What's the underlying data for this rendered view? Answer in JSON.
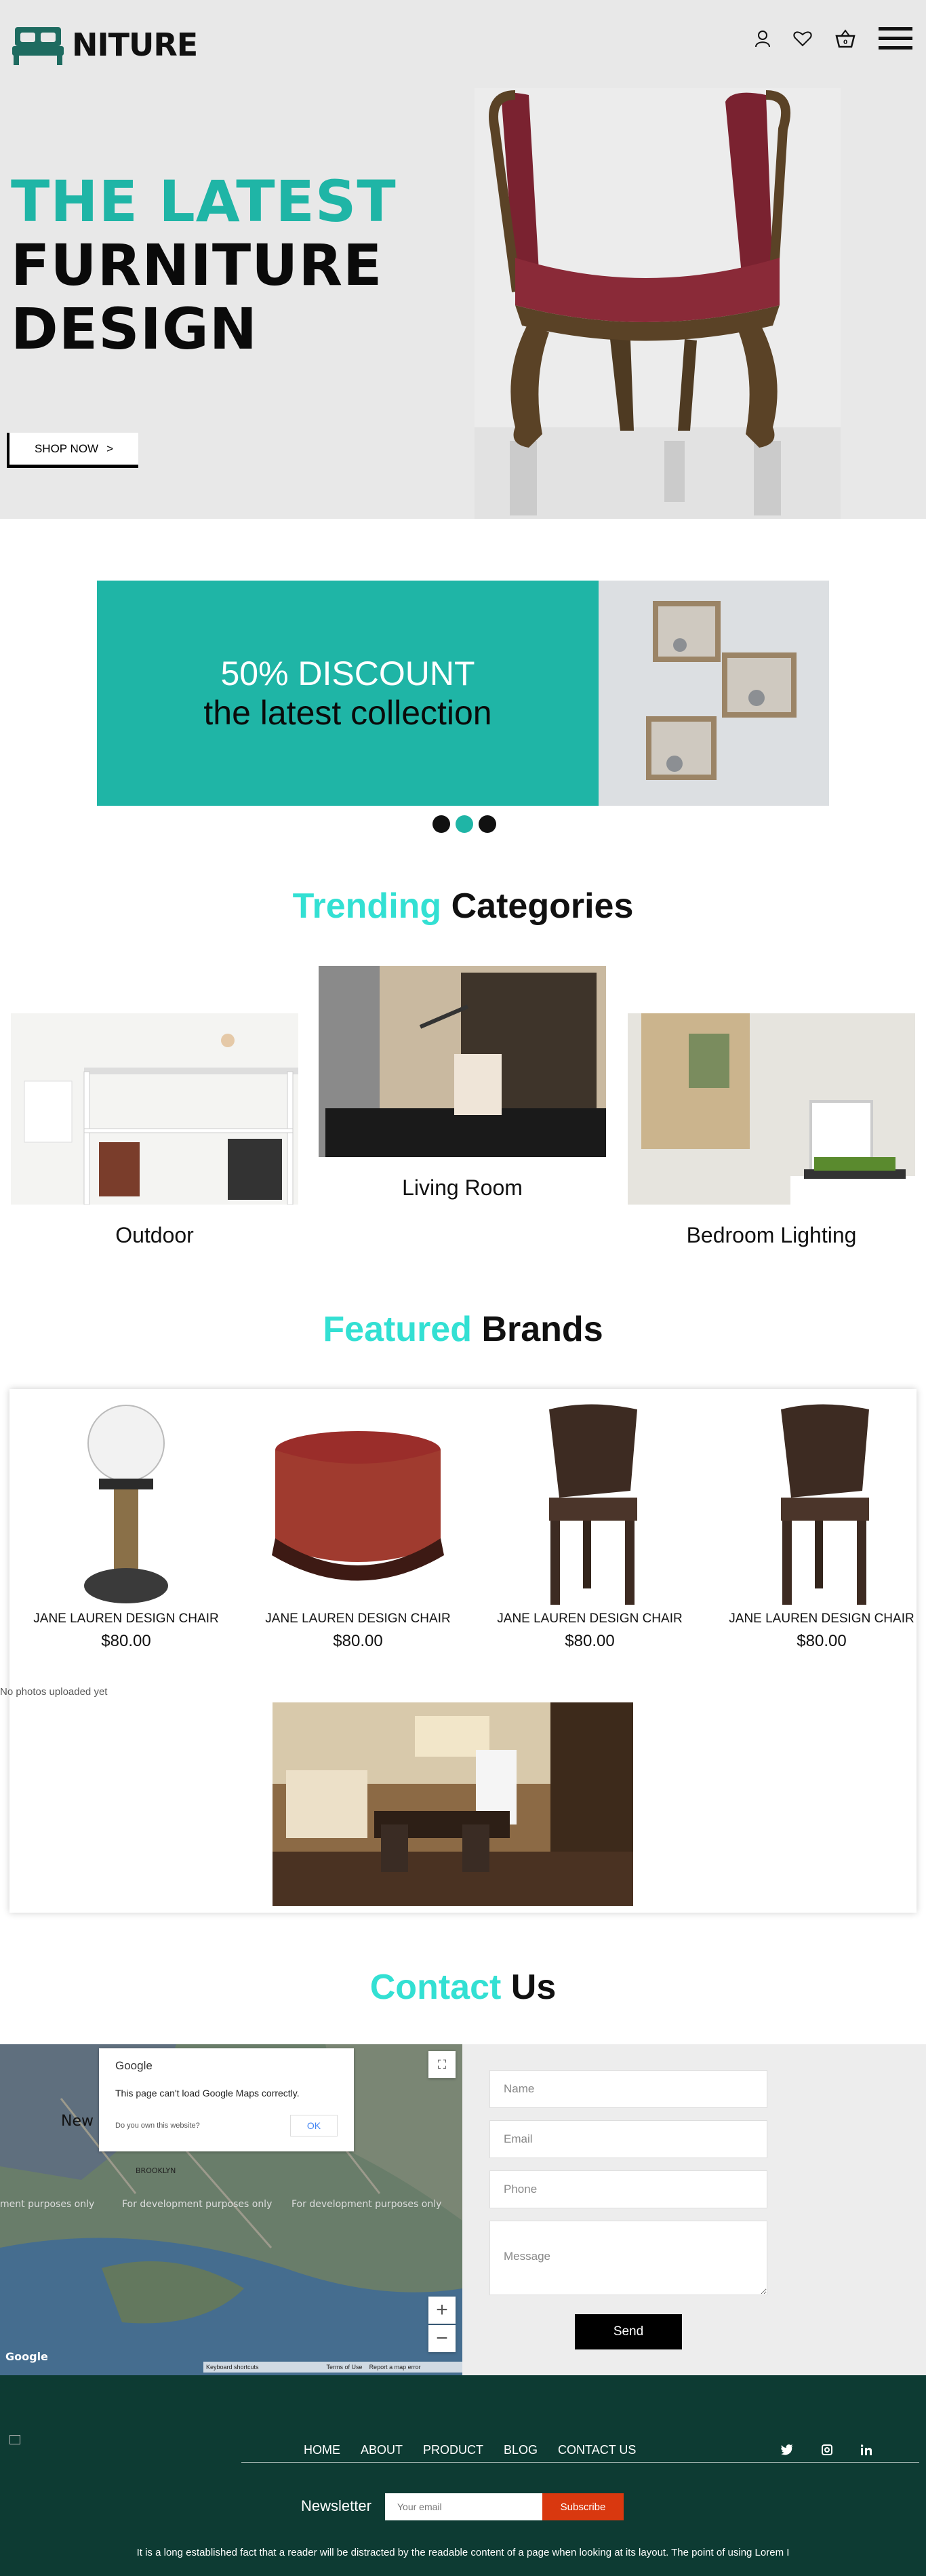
{
  "brand": {
    "name": "NITURE",
    "accent": "#1fb5a6",
    "dark": "#0d3b33"
  },
  "header": {
    "icons": [
      "user-icon",
      "heart-icon",
      "cart-icon",
      "menu-icon"
    ]
  },
  "hero": {
    "line1": "THE LATEST",
    "line2": "FURNITURE",
    "line3": "DESIGN",
    "cta": "SHOP NOW",
    "cta_arrow": ">"
  },
  "banner": {
    "line1": "50% DISCOUNT",
    "line2": "the latest collection",
    "slides": 3,
    "active_slide": 2
  },
  "trending": {
    "accent": "Trending",
    "rest": "Categories",
    "items": [
      {
        "label": "Outdoor"
      },
      {
        "label": "Living Room"
      },
      {
        "label": "Bedroom Lighting"
      }
    ]
  },
  "featured": {
    "accent": "Featured",
    "rest": "Brands",
    "products": [
      {
        "name": "JANE LAUREN DESIGN CHAIR",
        "price": "$80.00"
      },
      {
        "name": "JANE LAUREN DESIGN CHAIR",
        "price": "$80.00"
      },
      {
        "name": "JANE LAUREN DESIGN CHAIR",
        "price": "$80.00"
      },
      {
        "name": "JANE LAUREN DESIGN CHAIR",
        "price": "$80.00"
      }
    ],
    "no_photos": "No photos uploaded yet"
  },
  "contact": {
    "accent": "Contact",
    "rest": "Us",
    "map": {
      "google": "Google",
      "error": "This page can't load Google Maps correctly.",
      "own": "Do you own this website?",
      "ok": "OK",
      "dev_text": "For development purposes only",
      "zoom_in": "+",
      "zoom_out": "−",
      "footer_items": [
        "Keyboard shortcuts",
        "Terms of Use",
        "Report a map error"
      ]
    },
    "form": {
      "name_placeholder": "Name",
      "email_placeholder": "Email",
      "phone_placeholder": "Phone",
      "message_placeholder": "Message",
      "send": "Send"
    }
  },
  "footer": {
    "nav": [
      "HOME",
      "ABOUT",
      "PRODUCT",
      "BLOG",
      "CONTACT US"
    ],
    "social": [
      "twitter-icon",
      "instagram-icon",
      "linkedin-icon"
    ],
    "newsletter_label": "Newsletter",
    "email_placeholder": "Your email",
    "subscribe": "Subscribe",
    "text": "It is a long established fact that a reader will be distracted by the readable content of a page when looking at its layout. The point of using Lorem I"
  }
}
